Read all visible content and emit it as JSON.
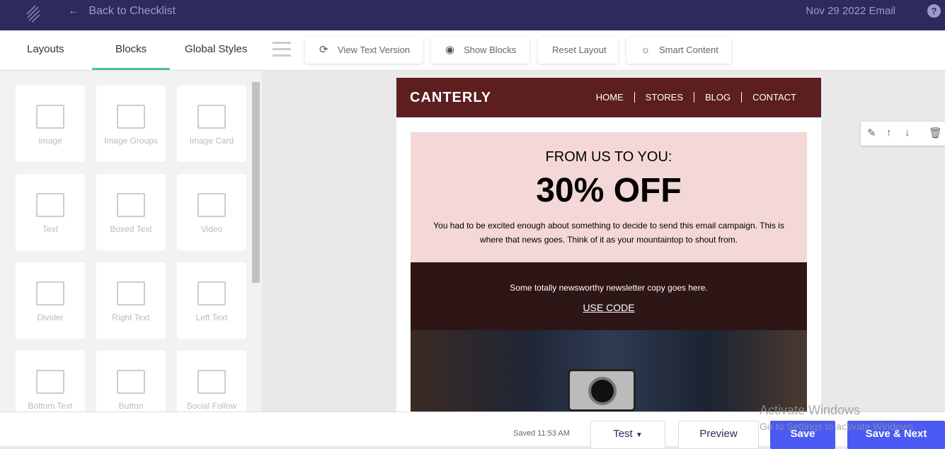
{
  "topbar": {
    "back_label": "Back to Checklist",
    "email_title": "Nov 29 2022 Email",
    "help": "?"
  },
  "tabs": [
    {
      "label": "Layouts"
    },
    {
      "label": "Blocks",
      "active": true
    },
    {
      "label": "Global Styles"
    }
  ],
  "toolbar": {
    "view_text": "View Text Version",
    "show_blocks": "Show Blocks",
    "reset_layout": "Reset Layout",
    "smart_content": "Smart Content"
  },
  "blocks": [
    {
      "label": "Image"
    },
    {
      "label": "Image Groups"
    },
    {
      "label": "Image Card"
    },
    {
      "label": "Text"
    },
    {
      "label": "Boxed Text"
    },
    {
      "label": "Video"
    },
    {
      "label": "Divider"
    },
    {
      "label": "Right Text"
    },
    {
      "label": "Left Text"
    },
    {
      "label": "Bottom Text"
    },
    {
      "label": "Button"
    },
    {
      "label": "Social Follow"
    }
  ],
  "email": {
    "brand": "CANTERLY",
    "nav": [
      "HOME",
      "STORES",
      "BLOG",
      "CONTACT"
    ],
    "eyebrow": "FROM US TO YOU:",
    "headline": "30% OFF",
    "body": "You had to be excited enough about something to decide to send this email campaign. This is where that news goes. Think of it as your mountaintop to shout from.",
    "dark_text": "Some totally newsworthy newsletter copy goes here.",
    "code_link": "USE CODE"
  },
  "footer": {
    "saved": "Saved 11:53 AM",
    "test": "Test",
    "preview": "Preview",
    "save": "Save",
    "save_next": "Save & Next"
  },
  "watermark": {
    "line1": "Activate Windows",
    "line2": "Go to Settings to activate Windows."
  },
  "colors": {
    "topbar": "#2c2a5f",
    "accent": "#49c59a",
    "primary": "#4a5af2",
    "email_header": "#5c1e1f"
  }
}
